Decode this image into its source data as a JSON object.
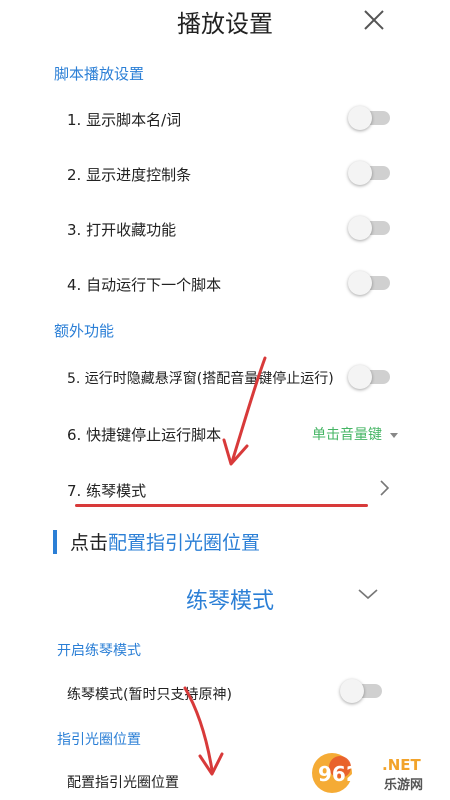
{
  "header": {
    "title": "播放设置",
    "close_icon": "close-icon"
  },
  "script_section": {
    "heading": "脚本播放设置",
    "rows": [
      {
        "label": "1. 显示脚本名/词",
        "toggle_on": false
      },
      {
        "label": "2. 显示进度控制条",
        "toggle_on": false
      },
      {
        "label": "3. 打开收藏功能",
        "toggle_on": false
      },
      {
        "label": "4. 自动运行下一个脚本",
        "toggle_on": false
      }
    ]
  },
  "extra_section": {
    "heading": "额外功能",
    "row5": {
      "label": "5. 运行时隐藏悬浮窗(搭配音量键停止运行)",
      "toggle_on": false
    },
    "row6": {
      "label": "6. 快捷键停止运行脚本",
      "dropdown_value": "单击音量键"
    },
    "row7": {
      "label": "7. 练琴模式",
      "chevron_icon": "chevron-right-icon"
    }
  },
  "callout": {
    "prefix": "点击",
    "link_text": "配置指引光圈位置"
  },
  "practice_panel": {
    "title": "练琴模式",
    "collapse_icon": "chevron-down-icon",
    "enable_heading": "开启练琴模式",
    "enable_row": {
      "label": "练琴模式(暂时只支持原神)",
      "toggle_on": false
    },
    "guide_heading": "指引光圈位置",
    "guide_row_label": "配置指引光圈位置"
  },
  "watermark": {
    "brand": "962",
    "suffix": ".NET",
    "site": "乐游网"
  },
  "colors": {
    "accent_blue": "#2b7fd6",
    "dropdown_green": "#45b564",
    "annotation_red": "#d83a3a"
  }
}
